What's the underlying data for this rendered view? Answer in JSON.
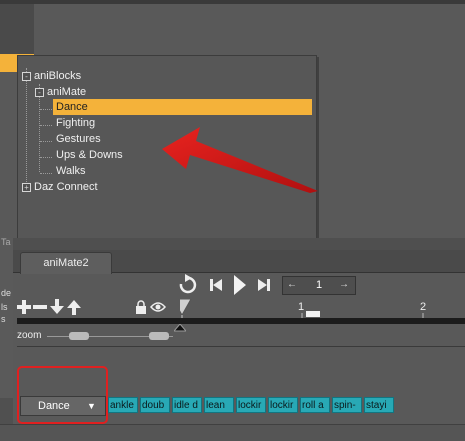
{
  "tree": {
    "items": [
      {
        "label": "aniBlocks",
        "expander": "-"
      },
      {
        "label": "aniMate",
        "expander": "-"
      },
      {
        "label": "Dance",
        "selected": true
      },
      {
        "label": "Fighting"
      },
      {
        "label": "Gestures"
      },
      {
        "label": "Ups & Downs"
      },
      {
        "label": "Walks"
      },
      {
        "label": "Daz Connect",
        "expander": "+"
      }
    ]
  },
  "left_edge": {
    "partial_tab": "Ta",
    "texts": [
      "de",
      "ls",
      "s"
    ]
  },
  "tab": {
    "label": "aniMate2"
  },
  "transport": {
    "frame_value": "1"
  },
  "ruler": {
    "ticks": [
      "1",
      "2"
    ]
  },
  "zoom": {
    "label": "zoom"
  },
  "clip_select": {
    "value": "Dance",
    "arrow": "▼"
  },
  "clips": [
    "ankle",
    "doub",
    "idle d",
    "lean",
    "lockir",
    "lockir",
    "roll a",
    "spin-",
    "stayi"
  ],
  "colors": {
    "selection": "#f4b23a",
    "clip_fill": "#28a9b5",
    "highlight_red": "#e02020"
  }
}
